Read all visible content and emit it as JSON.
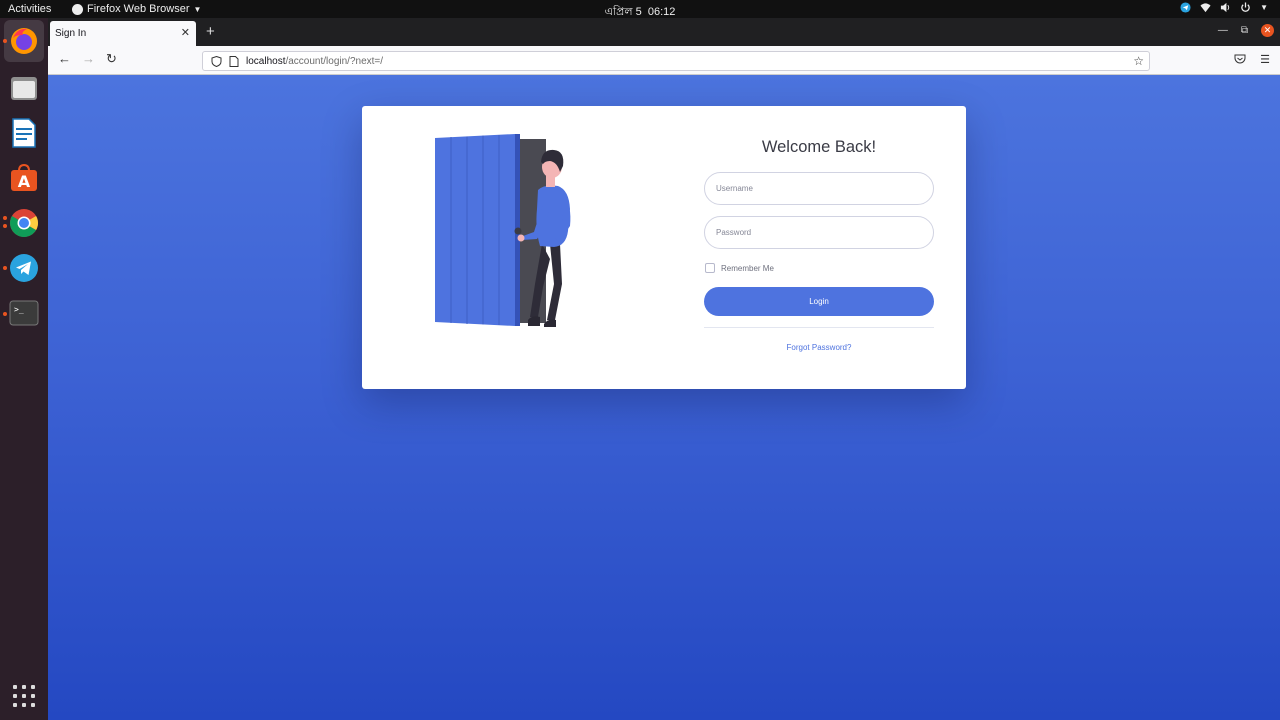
{
  "system": {
    "activities": "Activities",
    "app_menu": "Firefox Web Browser",
    "clock_date": "এপ্রিল 5",
    "clock_time": "06:12"
  },
  "dock": {
    "apps": [
      "firefox",
      "files",
      "libreoffice-writer",
      "ubuntu-software",
      "chrome",
      "telegram",
      "terminal"
    ]
  },
  "browser": {
    "tab_title": "Sign In",
    "url_host": "localhost",
    "url_path": "/account/login/?next=/"
  },
  "login": {
    "heading": "Welcome Back!",
    "username_placeholder": "Username",
    "password_placeholder": "Password",
    "remember_label": "Remember Me",
    "login_label": "Login",
    "forgot_label": "Forgot Password?"
  },
  "colors": {
    "primary": "#4e73df",
    "background_top": "#4c74de",
    "background_bottom": "#2448c2",
    "ubuntu_orange": "#e95420"
  }
}
